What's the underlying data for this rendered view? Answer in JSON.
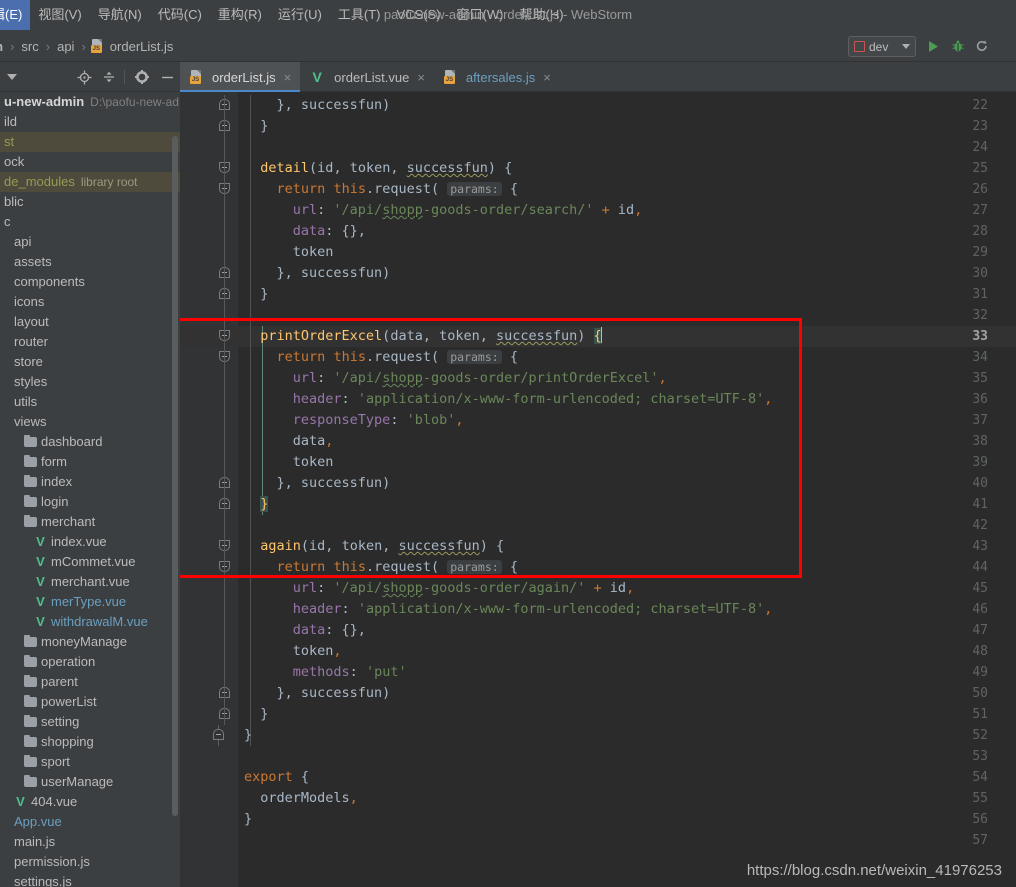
{
  "window": {
    "title": "paofu-new-admin - orderList.js - WebStorm"
  },
  "menubar": {
    "items": [
      {
        "label": "辑(E)"
      },
      {
        "label": "视图(V)"
      },
      {
        "label": "导航(N)"
      },
      {
        "label": "代码(C)"
      },
      {
        "label": "重构(R)"
      },
      {
        "label": "运行(U)"
      },
      {
        "label": "工具(T)"
      },
      {
        "label": "VCS(S)"
      },
      {
        "label": "窗口(W)"
      },
      {
        "label": "帮助(H)"
      }
    ]
  },
  "breadcrumb": {
    "items": [
      "dmin",
      "src",
      "api",
      "orderList.js"
    ],
    "separator": "›"
  },
  "toolbar": {
    "run_config_label": "dev",
    "run_icon": "run-play-icon",
    "debug_icon": "debug-bug-icon",
    "rerun_icon": "rerun-icon"
  },
  "project_panel": {
    "icons": [
      "collapse-arrow-icon",
      "locate-target-icon",
      "collapse-all-icon",
      "settings-gear-icon",
      "hide-minimize-icon"
    ],
    "tree": [
      {
        "label": "u-new-admin",
        "sub": "D:\\paofu-new-ad",
        "style": "bold",
        "indent": 0,
        "icon": "none",
        "highlight": false
      },
      {
        "label": "ild",
        "indent": 0,
        "icon": "none",
        "highlight": false
      },
      {
        "label": "st",
        "indent": 0,
        "icon": "none",
        "highlight": true,
        "style": "mod"
      },
      {
        "label": "ock",
        "indent": 0,
        "icon": "none",
        "highlight": false
      },
      {
        "label": "de_modules",
        "libroot": "library root",
        "indent": 0,
        "icon": "none",
        "highlight": true,
        "style": "mod"
      },
      {
        "label": "blic",
        "indent": 0,
        "icon": "none",
        "highlight": false
      },
      {
        "label": "c",
        "indent": 0,
        "icon": "none",
        "highlight": false
      },
      {
        "label": "api",
        "indent": 1,
        "icon": "none",
        "highlight": false
      },
      {
        "label": "assets",
        "indent": 1,
        "icon": "none",
        "highlight": false
      },
      {
        "label": "components",
        "indent": 1,
        "icon": "none",
        "highlight": false
      },
      {
        "label": "icons",
        "indent": 1,
        "icon": "none",
        "highlight": false
      },
      {
        "label": "layout",
        "indent": 1,
        "icon": "none",
        "highlight": false
      },
      {
        "label": "router",
        "indent": 1,
        "icon": "none",
        "highlight": false
      },
      {
        "label": "store",
        "indent": 1,
        "icon": "none",
        "highlight": false
      },
      {
        "label": "styles",
        "indent": 1,
        "icon": "none",
        "highlight": false
      },
      {
        "label": "utils",
        "indent": 1,
        "icon": "none",
        "highlight": false
      },
      {
        "label": "views",
        "indent": 1,
        "icon": "none",
        "highlight": false
      },
      {
        "label": "dashboard",
        "indent": 2,
        "icon": "folder",
        "highlight": false
      },
      {
        "label": "form",
        "indent": 2,
        "icon": "folder",
        "highlight": false
      },
      {
        "label": "index",
        "indent": 2,
        "icon": "folder",
        "highlight": false
      },
      {
        "label": "login",
        "indent": 2,
        "icon": "folder",
        "highlight": false
      },
      {
        "label": "merchant",
        "indent": 2,
        "icon": "folder",
        "highlight": false
      },
      {
        "label": "index.vue",
        "indent": 3,
        "icon": "vue",
        "highlight": false
      },
      {
        "label": "mCommet.vue",
        "indent": 3,
        "icon": "vue",
        "highlight": false
      },
      {
        "label": "merchant.vue",
        "indent": 3,
        "icon": "vue",
        "highlight": false
      },
      {
        "label": "merType.vue",
        "indent": 3,
        "icon": "vue",
        "highlight": false,
        "style": "blue"
      },
      {
        "label": "withdrawalM.vue",
        "indent": 3,
        "icon": "vue",
        "highlight": false,
        "style": "blue"
      },
      {
        "label": "moneyManage",
        "indent": 2,
        "icon": "folder",
        "highlight": false
      },
      {
        "label": "operation",
        "indent": 2,
        "icon": "folder",
        "highlight": false
      },
      {
        "label": "parent",
        "indent": 2,
        "icon": "folder",
        "highlight": false
      },
      {
        "label": "powerList",
        "indent": 2,
        "icon": "folder",
        "highlight": false
      },
      {
        "label": "setting",
        "indent": 2,
        "icon": "folder",
        "highlight": false
      },
      {
        "label": "shopping",
        "indent": 2,
        "icon": "folder",
        "highlight": false
      },
      {
        "label": "sport",
        "indent": 2,
        "icon": "folder",
        "highlight": false
      },
      {
        "label": "userManage",
        "indent": 2,
        "icon": "folder",
        "highlight": false
      },
      {
        "label": "404.vue",
        "indent": 1,
        "icon": "vue",
        "highlight": false
      },
      {
        "label": "App.vue",
        "indent": 1,
        "icon": "none",
        "highlight": false,
        "style": "blue"
      },
      {
        "label": "main.js",
        "indent": 1,
        "icon": "none",
        "highlight": false
      },
      {
        "label": "permission.js",
        "indent": 1,
        "icon": "none",
        "highlight": false
      },
      {
        "label": "settings.js",
        "indent": 1,
        "icon": "none",
        "highlight": false
      }
    ]
  },
  "editor_tabs": [
    {
      "label": "orderList.js",
      "icon": "js-file-icon",
      "active": true,
      "close": "×"
    },
    {
      "label": "orderList.vue",
      "icon": "vue-file-icon",
      "active": false,
      "close": "×"
    },
    {
      "label": "aftersales.js",
      "icon": "js-file-icon",
      "active": false,
      "close": "×",
      "style": "blue"
    }
  ],
  "editor": {
    "first_line_number": 22,
    "cursor_line": 33,
    "lines": [
      {
        "n": 22,
        "indent": 2,
        "tokens": [
          {
            "t": "}, ",
            "c": "t-id"
          },
          {
            "t": "successfun)",
            "c": "t-id"
          }
        ]
      },
      {
        "n": 23,
        "indent": 1,
        "tokens": [
          {
            "t": "}",
            "c": "t-id"
          }
        ]
      },
      {
        "n": 24,
        "indent": 0,
        "tokens": []
      },
      {
        "n": 25,
        "indent": 1,
        "tokens": [
          {
            "t": "detail",
            "c": "t-fn"
          },
          {
            "t": "(",
            "c": "t-id"
          },
          {
            "t": "id",
            "c": "t-id"
          },
          {
            "t": ", ",
            "c": "t-id"
          },
          {
            "t": "token",
            "c": "t-id"
          },
          {
            "t": ", ",
            "c": "t-id"
          },
          {
            "t": "successfun",
            "c": "t-id squiggle-g"
          },
          {
            "t": ") {",
            "c": "t-id"
          }
        ]
      },
      {
        "n": 26,
        "indent": 2,
        "tokens": [
          {
            "t": "return",
            "c": "t-kw"
          },
          {
            "t": " ",
            "c": "t-id"
          },
          {
            "t": "this",
            "c": "t-kw"
          },
          {
            "t": ".request( ",
            "c": "t-id"
          },
          {
            "t": "params:",
            "c": "t-hint"
          },
          {
            "t": " {",
            "c": "t-id"
          }
        ]
      },
      {
        "n": 27,
        "indent": 3,
        "tokens": [
          {
            "t": "url",
            "c": "t-prop"
          },
          {
            "t": ": ",
            "c": "t-id"
          },
          {
            "t": "'/api/",
            "c": "t-str"
          },
          {
            "t": "shopp",
            "c": "t-str squiggle"
          },
          {
            "t": "-goods-order/search/'",
            "c": "t-str"
          },
          {
            "t": " + ",
            "c": "t-kw"
          },
          {
            "t": "id",
            "c": "t-id"
          },
          {
            "t": ",",
            "c": "t-kw"
          }
        ]
      },
      {
        "n": 28,
        "indent": 3,
        "tokens": [
          {
            "t": "data",
            "c": "t-prop"
          },
          {
            "t": ": {},",
            "c": "t-id"
          }
        ]
      },
      {
        "n": 29,
        "indent": 3,
        "tokens": [
          {
            "t": "token",
            "c": "t-id"
          }
        ]
      },
      {
        "n": 30,
        "indent": 2,
        "tokens": [
          {
            "t": "}, successfun)",
            "c": "t-id"
          }
        ]
      },
      {
        "n": 31,
        "indent": 1,
        "tokens": [
          {
            "t": "}",
            "c": "t-id"
          }
        ]
      },
      {
        "n": 32,
        "indent": 0,
        "tokens": []
      },
      {
        "n": 33,
        "indent": 1,
        "tokens": [
          {
            "t": "printOrderExcel",
            "c": "t-fn"
          },
          {
            "t": "(",
            "c": "t-id"
          },
          {
            "t": "data",
            "c": "t-id"
          },
          {
            "t": ", ",
            "c": "t-id"
          },
          {
            "t": "token",
            "c": "t-id"
          },
          {
            "t": ", ",
            "c": "t-id"
          },
          {
            "t": "successfun",
            "c": "t-id squiggle-g"
          },
          {
            "t": ") ",
            "c": "t-id"
          },
          {
            "t": "{",
            "c": "brace-match"
          }
        ],
        "caret": true
      },
      {
        "n": 34,
        "indent": 2,
        "tokens": [
          {
            "t": "return",
            "c": "t-kw"
          },
          {
            "t": " ",
            "c": "t-id"
          },
          {
            "t": "this",
            "c": "t-kw"
          },
          {
            "t": ".request( ",
            "c": "t-id"
          },
          {
            "t": "params:",
            "c": "t-hint"
          },
          {
            "t": " {",
            "c": "t-id"
          }
        ]
      },
      {
        "n": 35,
        "indent": 3,
        "tokens": [
          {
            "t": "url",
            "c": "t-prop"
          },
          {
            "t": ": ",
            "c": "t-id"
          },
          {
            "t": "'/api/",
            "c": "t-str"
          },
          {
            "t": "shopp",
            "c": "t-str squiggle"
          },
          {
            "t": "-goods-order/printOrderExcel'",
            "c": "t-str"
          },
          {
            "t": ",",
            "c": "t-kw"
          }
        ]
      },
      {
        "n": 36,
        "indent": 3,
        "tokens": [
          {
            "t": "header",
            "c": "t-prop"
          },
          {
            "t": ": ",
            "c": "t-id"
          },
          {
            "t": "'application/x-www-form-urlencoded; charset=UTF-8'",
            "c": "t-str"
          },
          {
            "t": ",",
            "c": "t-kw"
          }
        ]
      },
      {
        "n": 37,
        "indent": 3,
        "tokens": [
          {
            "t": "responseType",
            "c": "t-prop"
          },
          {
            "t": ": ",
            "c": "t-id"
          },
          {
            "t": "'blob'",
            "c": "t-str"
          },
          {
            "t": ",",
            "c": "t-kw"
          }
        ]
      },
      {
        "n": 38,
        "indent": 3,
        "tokens": [
          {
            "t": "data",
            "c": "t-id"
          },
          {
            "t": ",",
            "c": "t-kw"
          }
        ]
      },
      {
        "n": 39,
        "indent": 3,
        "tokens": [
          {
            "t": "token",
            "c": "t-id"
          }
        ]
      },
      {
        "n": 40,
        "indent": 2,
        "tokens": [
          {
            "t": "}, successfun)",
            "c": "t-id"
          }
        ]
      },
      {
        "n": 41,
        "indent": 1,
        "tokens": [
          {
            "t": "}",
            "c": "brace-match"
          }
        ]
      },
      {
        "n": 42,
        "indent": 0,
        "tokens": []
      },
      {
        "n": 43,
        "indent": 1,
        "tokens": [
          {
            "t": "again",
            "c": "t-fn"
          },
          {
            "t": "(",
            "c": "t-id"
          },
          {
            "t": "id",
            "c": "t-id"
          },
          {
            "t": ", ",
            "c": "t-id"
          },
          {
            "t": "token",
            "c": "t-id"
          },
          {
            "t": ", ",
            "c": "t-id"
          },
          {
            "t": "successfun",
            "c": "t-id squiggle-g"
          },
          {
            "t": ") {",
            "c": "t-id"
          }
        ]
      },
      {
        "n": 44,
        "indent": 2,
        "tokens": [
          {
            "t": "return",
            "c": "t-kw"
          },
          {
            "t": " ",
            "c": "t-id"
          },
          {
            "t": "this",
            "c": "t-kw"
          },
          {
            "t": ".request( ",
            "c": "t-id"
          },
          {
            "t": "params:",
            "c": "t-hint"
          },
          {
            "t": " {",
            "c": "t-id"
          }
        ]
      },
      {
        "n": 45,
        "indent": 3,
        "tokens": [
          {
            "t": "url",
            "c": "t-prop"
          },
          {
            "t": ": ",
            "c": "t-id"
          },
          {
            "t": "'/api/",
            "c": "t-str"
          },
          {
            "t": "shopp",
            "c": "t-str squiggle"
          },
          {
            "t": "-goods-order/again/'",
            "c": "t-str"
          },
          {
            "t": " + ",
            "c": "t-kw"
          },
          {
            "t": "id",
            "c": "t-id"
          },
          {
            "t": ",",
            "c": "t-kw"
          }
        ]
      },
      {
        "n": 46,
        "indent": 3,
        "tokens": [
          {
            "t": "header",
            "c": "t-prop"
          },
          {
            "t": ": ",
            "c": "t-id"
          },
          {
            "t": "'application/x-www-form-urlencoded; charset=UTF-8'",
            "c": "t-str"
          },
          {
            "t": ",",
            "c": "t-kw"
          }
        ]
      },
      {
        "n": 47,
        "indent": 3,
        "tokens": [
          {
            "t": "data",
            "c": "t-prop"
          },
          {
            "t": ": {},",
            "c": "t-id"
          }
        ]
      },
      {
        "n": 48,
        "indent": 3,
        "tokens": [
          {
            "t": "token",
            "c": "t-id"
          },
          {
            "t": ",",
            "c": "t-kw"
          }
        ]
      },
      {
        "n": 49,
        "indent": 3,
        "tokens": [
          {
            "t": "methods",
            "c": "t-prop"
          },
          {
            "t": ": ",
            "c": "t-id"
          },
          {
            "t": "'put'",
            "c": "t-str"
          }
        ]
      },
      {
        "n": 50,
        "indent": 2,
        "tokens": [
          {
            "t": "}, successfun)",
            "c": "t-id"
          }
        ]
      },
      {
        "n": 51,
        "indent": 1,
        "tokens": [
          {
            "t": "}",
            "c": "t-id"
          }
        ]
      },
      {
        "n": 52,
        "indent": 0,
        "tokens": [
          {
            "t": "}",
            "c": "t-id"
          }
        ]
      },
      {
        "n": 53,
        "indent": 0,
        "tokens": []
      },
      {
        "n": 54,
        "indent": 0,
        "tokens": [
          {
            "t": "export",
            "c": "t-kw"
          },
          {
            "t": " {",
            "c": "t-id"
          }
        ]
      },
      {
        "n": 55,
        "indent": 1,
        "tokens": [
          {
            "t": "orderModels",
            "c": "t-id"
          },
          {
            "t": ",",
            "c": "t-kw"
          }
        ]
      },
      {
        "n": 56,
        "indent": 0,
        "tokens": [
          {
            "t": "}",
            "c": "t-id"
          }
        ]
      },
      {
        "n": 57,
        "indent": 0,
        "tokens": []
      }
    ]
  },
  "annotation": {
    "shape": "rectangle",
    "color": "#ff0000",
    "covers_lines": "33-44"
  },
  "watermark": {
    "text": "https://blog.csdn.net/weixin_41976253"
  }
}
